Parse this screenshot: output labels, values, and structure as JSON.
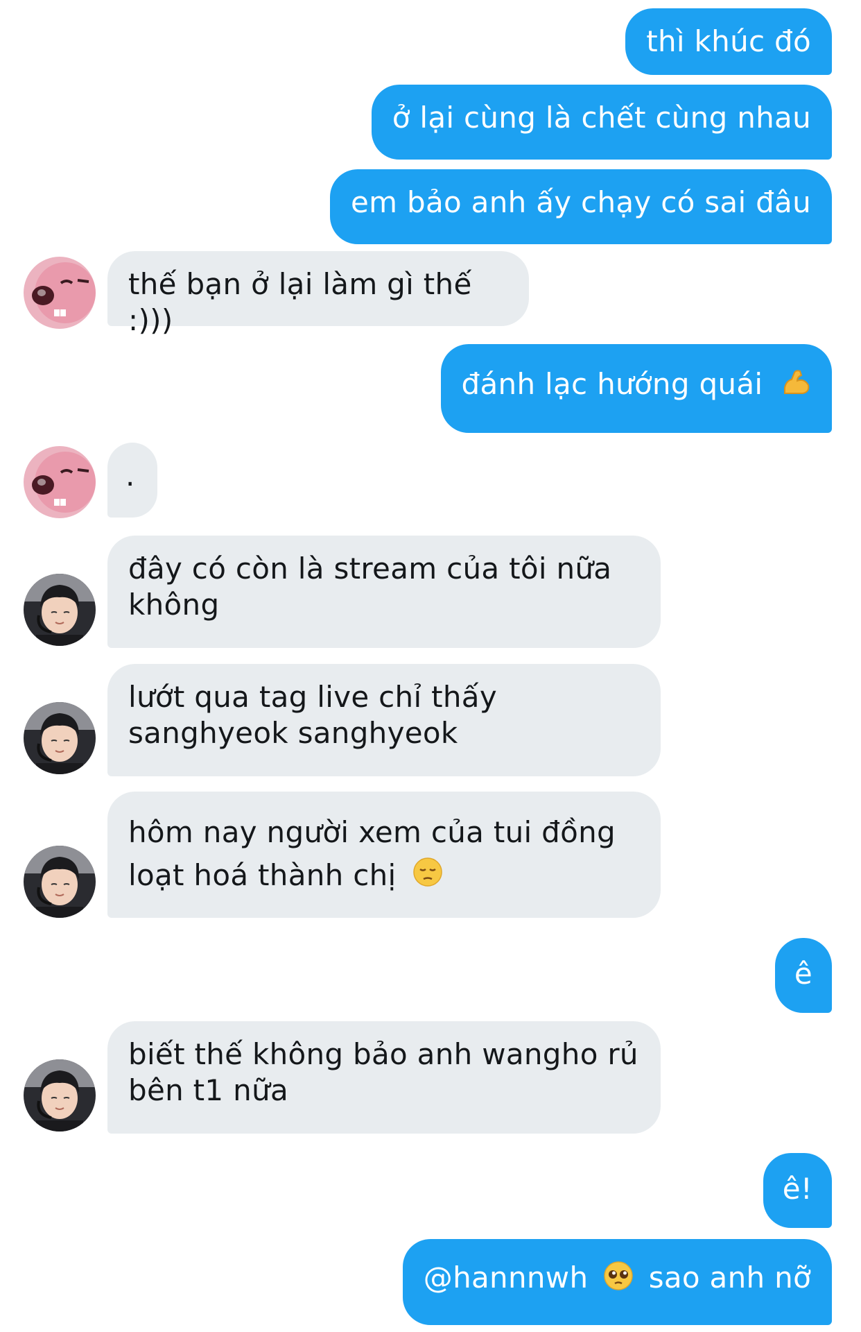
{
  "conversation": {
    "messages": [
      {
        "id": "m1",
        "side": "out",
        "text": "thì khúc đó"
      },
      {
        "id": "m2",
        "side": "out",
        "text": "ở lại cùng là chết cùng nhau"
      },
      {
        "id": "m3",
        "side": "out",
        "text": "em bảo anh ấy chạy có sai đâu"
      },
      {
        "id": "m4",
        "side": "in",
        "sender_avatar": "pink-beaver-avatar",
        "text": "thế bạn ở lại làm gì thế :)))"
      },
      {
        "id": "m5",
        "side": "out",
        "text": "đánh lạc hướng quái",
        "emoji": "flexed-biceps-icon"
      },
      {
        "id": "m6",
        "side": "in",
        "sender_avatar": "pink-beaver-avatar",
        "text": "."
      },
      {
        "id": "m7",
        "side": "in",
        "sender_avatar": "gamer-photo-avatar",
        "text": "đây có còn là stream của tôi nữa không"
      },
      {
        "id": "m8",
        "side": "in",
        "sender_avatar": "gamer-photo-avatar",
        "text": "lướt qua tag live chỉ thấy sanghyeok sanghyeok"
      },
      {
        "id": "m9",
        "side": "in",
        "sender_avatar": "gamer-photo-avatar",
        "text": "hôm nay người xem của tui đồng loạt hoá thành chị",
        "emoji": "pensive-face-icon"
      },
      {
        "id": "m10",
        "side": "out",
        "text": "ê"
      },
      {
        "id": "m11",
        "side": "in",
        "sender_avatar": "gamer-photo-avatar",
        "text": "biết thế không bảo anh wangho rủ bên t1 nữa"
      },
      {
        "id": "m12",
        "side": "out",
        "text": "ê!"
      },
      {
        "id": "m13",
        "side": "out",
        "text_before": "@hannnwh",
        "emoji": "pleading-face-icon",
        "text_after": "sao anh nỡ"
      }
    ]
  },
  "colors": {
    "outgoing_bubble": "#1da1f2",
    "incoming_bubble": "#e8ecef",
    "outgoing_text": "#ffffff",
    "incoming_text": "#14171a"
  }
}
